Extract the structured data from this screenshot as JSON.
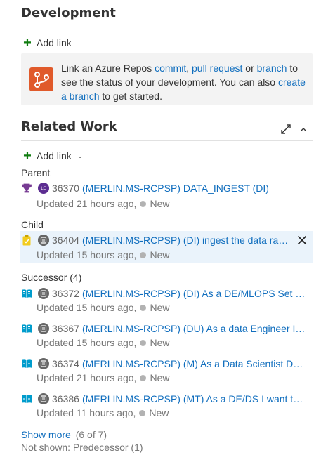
{
  "development": {
    "title": "Development",
    "add_link_label": "Add link",
    "info": {
      "text_1": "Link an Azure Repos ",
      "commit": "commit",
      "sep_1": ", ",
      "pull_request": "pull request",
      "text_2": " or ",
      "branch": "branch",
      "text_3": " to see the status of your development. You can also ",
      "create_branch": "create a branch",
      "text_4": " to get started."
    }
  },
  "related_work": {
    "title": "Related Work",
    "add_link_label": "Add link",
    "groups": {
      "parent": {
        "label": "Parent",
        "items": [
          {
            "id": "36370",
            "title": "(MERLIN.MS-RCPSP) DATA_INGEST (DI)",
            "updated": "Updated 21 hours ago,",
            "state": "New",
            "avatar_initials": "LC"
          }
        ]
      },
      "child": {
        "label": "Child",
        "items": [
          {
            "id": "36404",
            "title": "(MERLIN.MS-RCPSP) (DI) ingest the data raw data",
            "updated": "Updated 15 hours ago,",
            "state": "New"
          }
        ]
      },
      "successor": {
        "label": "Successor (4)",
        "items": [
          {
            "id": "36372",
            "title": "(MERLIN.MS-RCPSP) (DI) As a DE/MLOPS Set up ...",
            "updated": "Updated 15 hours ago,",
            "state": "New"
          },
          {
            "id": "36367",
            "title": "(MERLIN.MS-RCPSP) (DU) As a data Engineer I w...",
            "updated": "Updated 15 hours ago,",
            "state": "New"
          },
          {
            "id": "36374",
            "title": "(MERLIN.MS-RCPSP) (M) As a Data Scientist DS I...",
            "updated": "Updated 21 hours ago,",
            "state": "New"
          },
          {
            "id": "36386",
            "title": "(MERLIN.MS-RCPSP) (MT) As a DE/DS I want to ...",
            "updated": "Updated 11 hours ago,",
            "state": "New"
          }
        ]
      }
    },
    "show_more": "Show more",
    "show_more_count": "(6 of 7)",
    "not_shown": "Not shown: Predecessor (1)"
  },
  "icons": {
    "add": "plus-icon",
    "repo": "azure-repos-icon",
    "expand": "expand-icon",
    "collapse": "chevron-up-icon",
    "epic": "trophy-icon",
    "task": "clipboard-icon",
    "story": "book-icon",
    "remove": "close-icon"
  },
  "colors": {
    "link": "#106ebe",
    "add": "#107c10",
    "epic": "#773b93",
    "task": "#f2cb1d",
    "story": "#009ccc",
    "repo": "#e05a2b",
    "state_dot": "#b2b2b2",
    "highlight": "#eaf3fb"
  }
}
